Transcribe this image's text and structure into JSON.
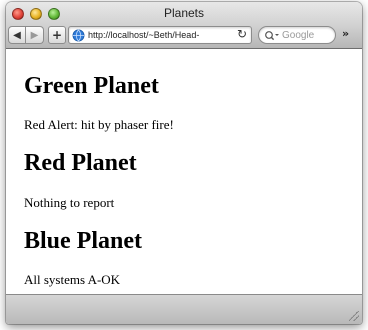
{
  "window": {
    "title": "Planets"
  },
  "toolbar": {
    "back_icon": "back-arrow-icon",
    "forward_icon": "forward-arrow-icon",
    "add_icon": "plus-icon",
    "back_label": "◀",
    "forward_label": "▶",
    "add_label": "+",
    "url": "http://localhost/~Beth/Head-",
    "reload_label": "↻",
    "search_placeholder": "Google",
    "overflow_label": "»"
  },
  "content": {
    "sections": [
      {
        "heading": "Green Planet",
        "text": "Red Alert: hit by phaser fire!"
      },
      {
        "heading": "Red Planet",
        "text": "Nothing to report"
      },
      {
        "heading": "Blue Planet",
        "text": "All systems A-OK"
      }
    ]
  },
  "colors": {
    "close": "#e0443a",
    "minimize": "#e8b323",
    "zoom": "#62b938",
    "globe": "#2f7bd9"
  }
}
